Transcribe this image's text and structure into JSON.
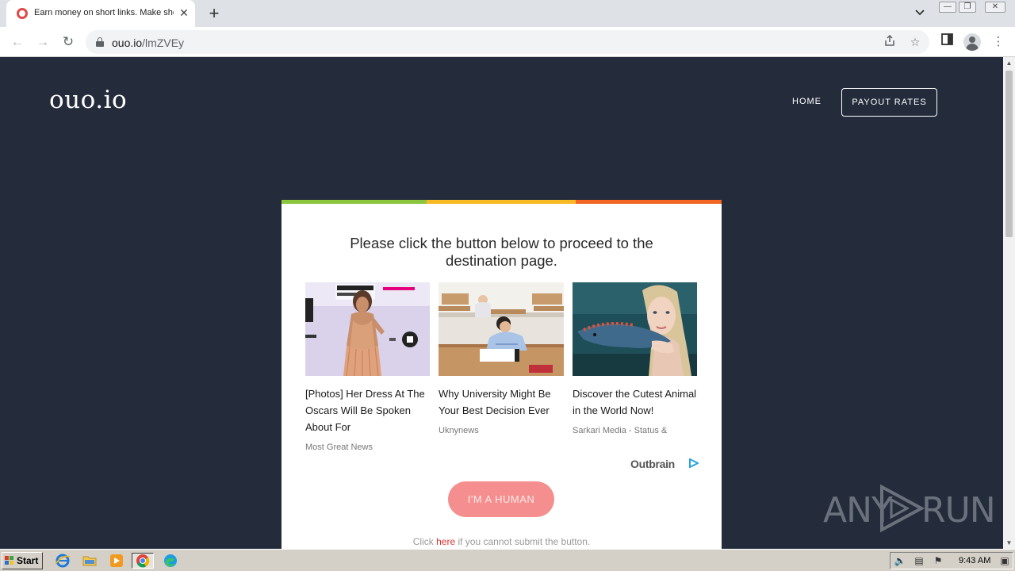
{
  "browser": {
    "tab_title": "Earn money on short links. Make sho",
    "new_tab_symbol": "+",
    "close_symbol": "✕",
    "url_host": "ouo.io",
    "url_path": "/lmZVEy"
  },
  "site": {
    "logo": "ouo.io",
    "nav": {
      "home": "HOME",
      "payout_rates": "PAYOUT RATES"
    }
  },
  "card": {
    "accent_colors": [
      "#8cc63f",
      "#f7b924",
      "#f26522"
    ],
    "headline": "Please click the button below to proceed to the destination page.",
    "ads": [
      {
        "title": "[Photos] Her Dress At The Oscars Will Be Spoken About For",
        "source": "Most Great News",
        "image": "red-carpet-photo"
      },
      {
        "title": "Why University Might Be Your Best Decision Ever",
        "source": "Uknynews",
        "image": "classroom-photo"
      },
      {
        "title": "Discover the Cutest Animal in the World Now!",
        "source": "Sarkari Media - Status &",
        "image": "woman-with-axolotl-photo"
      }
    ],
    "ad_network": "Outbrain",
    "button": "I'M A HUMAN",
    "fallback_prefix": "Click ",
    "fallback_link": "here",
    "fallback_suffix": " if you cannot submit the button."
  },
  "watermark": {
    "left": "ANY",
    "right": "RUN"
  },
  "taskbar": {
    "start": "Start",
    "clock": "9:43 AM",
    "apps": [
      "internet-explorer-icon",
      "file-explorer-icon",
      "media-player-icon",
      "chrome-icon",
      "edge-icon"
    ]
  }
}
